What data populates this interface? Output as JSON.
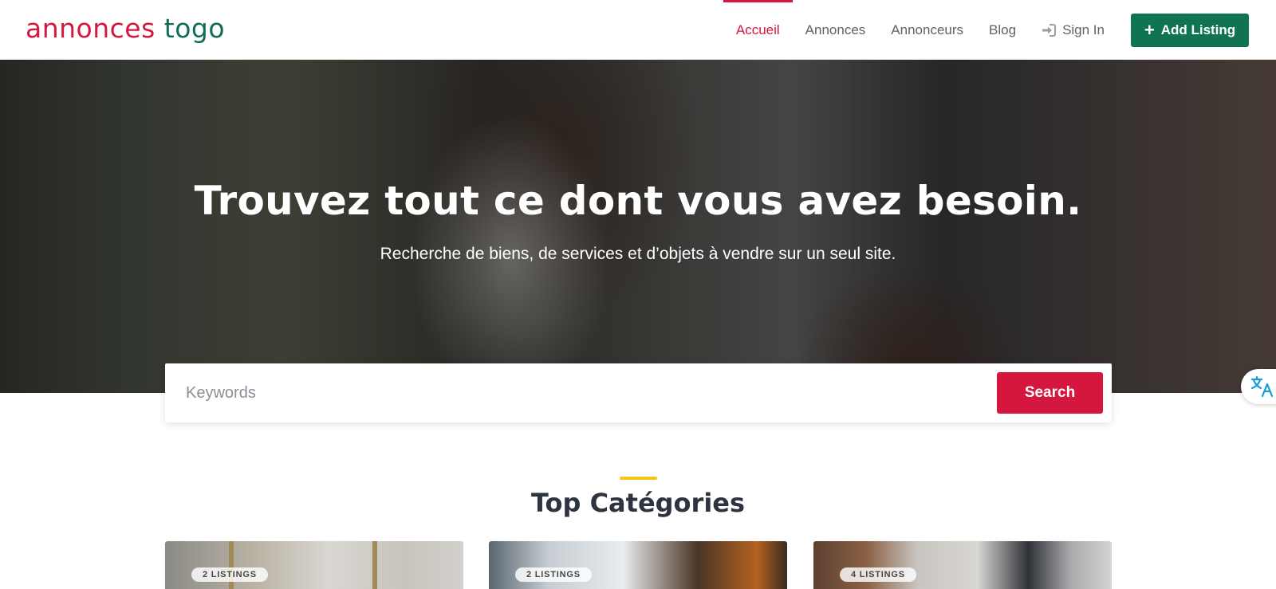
{
  "header": {
    "logo": {
      "part1": "annonces",
      "part2": " togo"
    },
    "nav": [
      {
        "label": "Accueil",
        "active": true
      },
      {
        "label": "Annonces"
      },
      {
        "label": "Annonceurs"
      },
      {
        "label": "Blog"
      }
    ],
    "sign_in": {
      "label": "Sign In",
      "icon": "sign-in-icon"
    },
    "add_listing": {
      "label": "Add Listing",
      "icon": "plus-icon"
    }
  },
  "hero": {
    "title": "Trouvez tout ce dont vous avez besoin.",
    "subtitle": "Recherche de biens, de services et d’objets à vendre sur un seul site."
  },
  "search": {
    "placeholder": "Keywords",
    "value": "",
    "button_label": "Search"
  },
  "translate_widget": {
    "icon": "translate-icon"
  },
  "section": {
    "title": "Top Catégories"
  },
  "categories": [
    {
      "badge": "2 LISTINGS"
    },
    {
      "badge": "2 LISTINGS"
    },
    {
      "badge": "4 LISTINGS"
    }
  ],
  "colors": {
    "brand_red": "#d6173d",
    "brand_green": "#107453",
    "accent_yellow": "#f5c518",
    "heading": "#2d3440"
  }
}
